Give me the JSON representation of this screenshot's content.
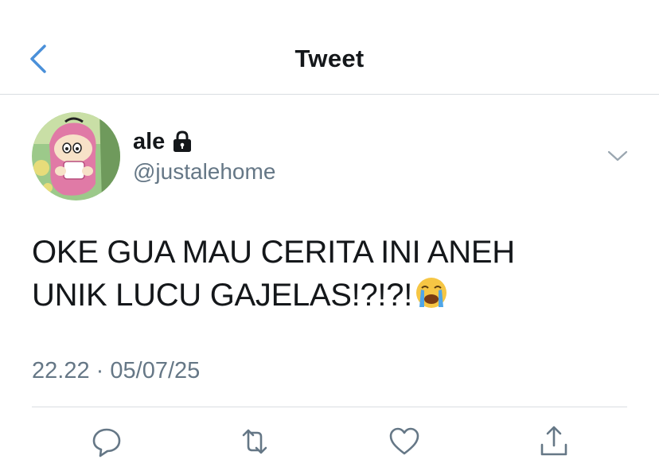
{
  "header": {
    "title": "Tweet",
    "back_icon": "chevron-left-icon"
  },
  "tweet": {
    "author": {
      "name": "ale",
      "handle": "@justalehome",
      "protected_icon": "lock-icon"
    },
    "text_line1": "OKE GUA MAU CERITA INI ANEH",
    "text_line2": "UNIK LUCU GAJELAS!?!?!",
    "emoji": "loudly-crying-face",
    "time": "22.22",
    "date": "05/07/25",
    "separator": "·"
  },
  "actions": [
    "reply-icon",
    "retweet-icon",
    "like-icon",
    "share-icon"
  ],
  "colors": {
    "accent": "#4a90d9",
    "muted": "#657786",
    "divider": "#d9dde1",
    "text": "#14171a"
  }
}
